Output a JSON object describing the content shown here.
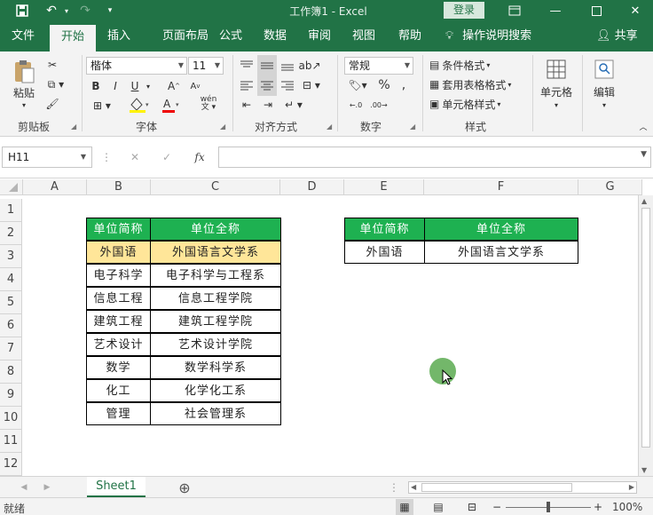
{
  "titlebar": {
    "doc_title": "工作簿1  -  Excel",
    "login": "登录"
  },
  "ribbon_tabs": [
    "文件",
    "开始",
    "插入",
    "页面布局",
    "公式",
    "数据",
    "审阅",
    "视图",
    "帮助"
  ],
  "tell_me": "操作说明搜索",
  "share": "共享",
  "ribbon": {
    "clipboard": {
      "paste": "粘贴",
      "label": "剪贴板"
    },
    "font": {
      "name": "楷体",
      "size": "11",
      "label": "字体",
      "bold": "B",
      "italic": "I",
      "underline": "U",
      "wen": "wén"
    },
    "alignment": {
      "label": "对齐方式"
    },
    "number": {
      "format": "常规",
      "label": "数字"
    },
    "styles": {
      "conditional": "条件格式",
      "table": "套用表格格式",
      "cell_styles": "单元格样式",
      "label": "样式"
    },
    "cells": {
      "label": "单元格"
    },
    "editing": {
      "label": "编辑"
    }
  },
  "formula_bar": {
    "name_box": "H11",
    "fx": "fx",
    "value": ""
  },
  "columns": [
    "A",
    "B",
    "C",
    "D",
    "E",
    "F",
    "G"
  ],
  "rows": [
    "1",
    "2",
    "3",
    "4",
    "5",
    "6",
    "7",
    "8",
    "9",
    "10",
    "11",
    "12"
  ],
  "table1": {
    "headers": [
      "单位简称",
      "单位全称"
    ],
    "rows": [
      [
        "外国语",
        "外国语言文学系"
      ],
      [
        "电子科学",
        "电子科学与工程系"
      ],
      [
        "信息工程",
        "信息工程学院"
      ],
      [
        "建筑工程",
        "建筑工程学院"
      ],
      [
        "艺术设计",
        "艺术设计学院"
      ],
      [
        "数学",
        "数学科学系"
      ],
      [
        "化工",
        "化学化工系"
      ],
      [
        "管理",
        "社会管理系"
      ]
    ]
  },
  "table2": {
    "headers": [
      "单位简称",
      "单位全称"
    ],
    "rows": [
      [
        "外国语",
        "外国语言文学系"
      ]
    ]
  },
  "sheet_tab": "Sheet1",
  "status": {
    "ready": "就绪",
    "zoom": "100%"
  },
  "colors": {
    "excel_green": "#217346",
    "header_green": "#1eb151",
    "highlight": "#ffe699"
  }
}
